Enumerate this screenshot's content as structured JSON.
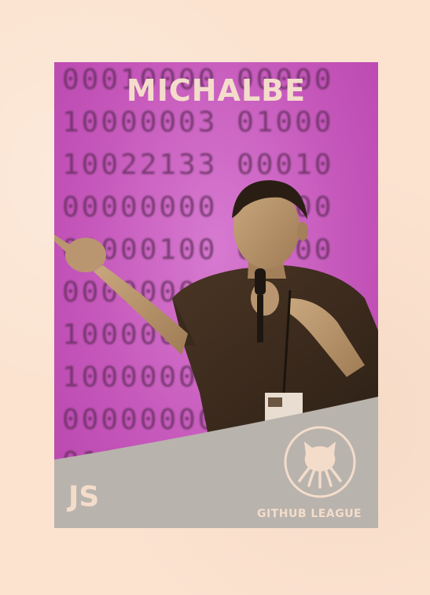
{
  "card": {
    "player_name": "MICHALBE",
    "language": "JS",
    "league": "GITHUB LEAGUE",
    "code_rows": [
      "00010000 00000",
      "10000003 01000",
      "10022133 00010",
      "00000000 00000",
      "01000100 00000",
      "00000000 00000",
      "10000000 00000",
      "10000000 00000",
      "00000000 00000",
      "01000000 00000"
    ]
  },
  "icons": {
    "league_logo": "octocat-icon"
  },
  "colors": {
    "background": "#fbe3d0",
    "card_magenta": "#c95dbf",
    "panel_gray": "#b9b3ad",
    "text_cream": "#f4dccb"
  }
}
